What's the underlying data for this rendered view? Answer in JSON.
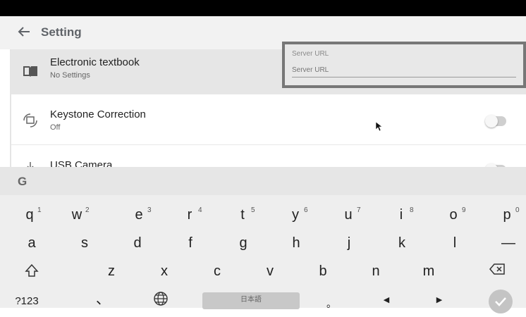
{
  "header": {
    "title": "Setting"
  },
  "settings": [
    {
      "title": "Electronic textbook",
      "subtitle": "No Settings",
      "icon": "book-icon"
    },
    {
      "title": "Keystone Correction",
      "subtitle": "Off",
      "icon": "keystone-rotate-icon",
      "toggle": "off"
    },
    {
      "title": "USB Camera",
      "subtitle": "",
      "icon": "usb-icon",
      "toggle": "off"
    }
  ],
  "server_popup": {
    "label": "Server URL",
    "placeholder": "Server URL",
    "value": ""
  },
  "keyboard": {
    "logo": "G",
    "row1": [
      {
        "k": "q",
        "n": "1"
      },
      {
        "k": "w",
        "n": "2"
      },
      {
        "k": "e",
        "n": "3"
      },
      {
        "k": "r",
        "n": "4"
      },
      {
        "k": "t",
        "n": "5"
      },
      {
        "k": "y",
        "n": "6"
      },
      {
        "k": "u",
        "n": "7"
      },
      {
        "k": "i",
        "n": "8"
      },
      {
        "k": "o",
        "n": "9"
      },
      {
        "k": "p",
        "n": "0"
      }
    ],
    "row2": [
      "a",
      "s",
      "d",
      "f",
      "g",
      "h",
      "j",
      "k",
      "l",
      "—"
    ],
    "row3": [
      "z",
      "x",
      "c",
      "v",
      "b",
      "n",
      "m"
    ],
    "row4": {
      "symbols": "?123",
      "comma": "、",
      "space": "日本語",
      "period": "。",
      "left": "◀",
      "right": "▶"
    }
  },
  "colors": {
    "accent": "#5f6368",
    "toggle_off": "#cfcfcf",
    "popup_border": "#777777"
  }
}
